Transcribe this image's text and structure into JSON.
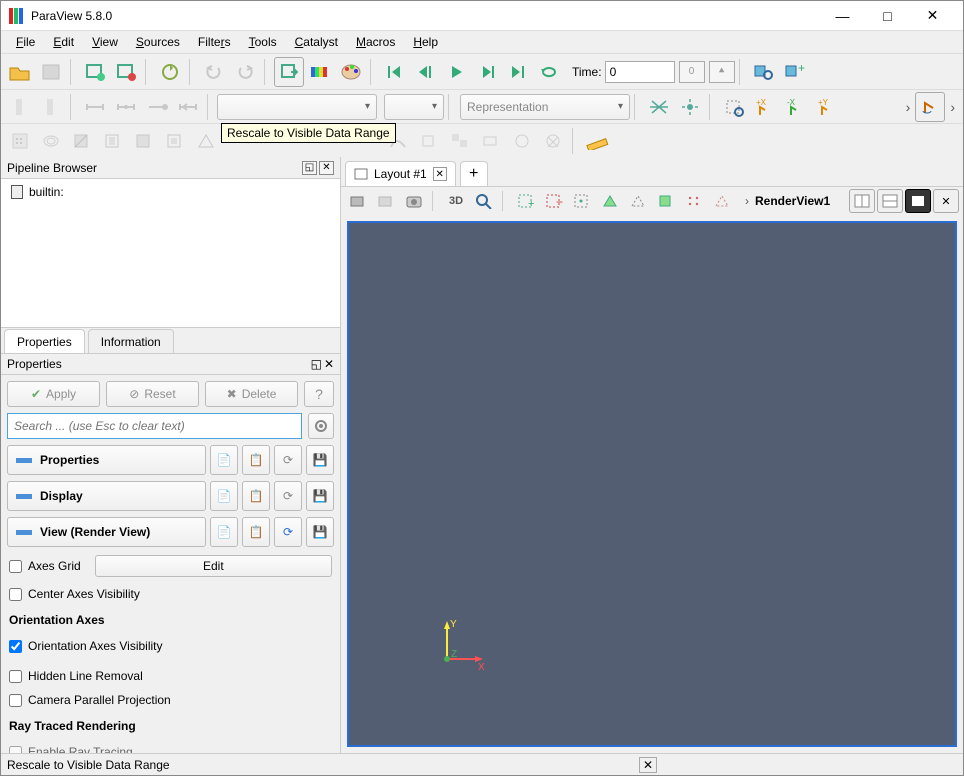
{
  "app": {
    "title": "ParaView 5.8.0"
  },
  "menu": {
    "file": "File",
    "edit": "Edit",
    "view": "View",
    "sources": "Sources",
    "filters": "Filters",
    "tools": "Tools",
    "catalyst": "Catalyst",
    "macros": "Macros",
    "help": "Help"
  },
  "toolbar": {
    "time_label": "Time:",
    "time_value": "0",
    "frame": "0",
    "representation_placeholder": "Representation"
  },
  "tooltip": "Rescale to Visible Data Range",
  "pipeline": {
    "title": "Pipeline Browser",
    "root": "builtin:"
  },
  "tabs": {
    "properties": "Properties",
    "information": "Information"
  },
  "properties": {
    "title": "Properties",
    "apply": "Apply",
    "reset": "Reset",
    "delete": "Delete",
    "help": "?",
    "search_placeholder": "Search ... (use Esc to clear text)",
    "section_properties": "Properties",
    "section_display": "Display",
    "section_view": "View (Render View)",
    "axes_grid": "Axes Grid",
    "edit": "Edit",
    "center_axes": "Center Axes Visibility",
    "orientation_axes_hdr": "Orientation Axes",
    "orientation_axes_vis": "Orientation Axes Visibility",
    "hidden_line": "Hidden Line Removal",
    "camera_parallel": "Camera Parallel Projection",
    "ray_traced_hdr": "Ray Traced Rendering",
    "enable_ray": "Enable Ray Tracing"
  },
  "layout": {
    "tab1": "Layout #1",
    "view_name": "RenderView1",
    "mode_3d": "3D"
  },
  "axes": {
    "x": "X",
    "y": "Y",
    "z": "Z"
  },
  "status": "Rescale to Visible Data Range"
}
